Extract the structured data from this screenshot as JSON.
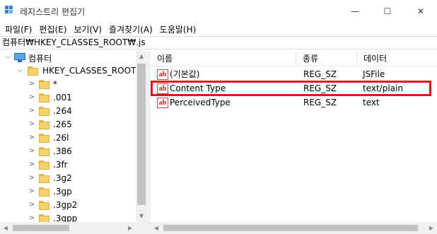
{
  "window": {
    "title": "레지스트리 편집기",
    "icon": "registry-editor-icon",
    "controls": {
      "minimize": "—",
      "maximize": "☐",
      "close": "✕"
    }
  },
  "menu": [
    {
      "label": "파일(F)"
    },
    {
      "label": "편집(E)"
    },
    {
      "label": "보기(V)"
    },
    {
      "label": "즐겨찾기(A)"
    },
    {
      "label": "도움말(H)"
    }
  ],
  "address": "컴퓨터₩HKEY_CLASSES_ROOT₩.js",
  "tree": {
    "root": {
      "label": "컴퓨터",
      "expander": "⌵",
      "icon": "computer-icon"
    },
    "hive": {
      "label": "HKEY_CLASSES_ROOT",
      "expander": "⌵"
    },
    "children": [
      {
        "label": "*"
      },
      {
        "label": ".001"
      },
      {
        "label": ".264"
      },
      {
        "label": ".265"
      },
      {
        "label": ".26l"
      },
      {
        "label": ".386"
      },
      {
        "label": ".3fr"
      },
      {
        "label": ".3g2"
      },
      {
        "label": ".3gp"
      },
      {
        "label": ".3gp2"
      },
      {
        "label": ".3gpp"
      }
    ],
    "child_expander": ">"
  },
  "list": {
    "columns": [
      "이름",
      "종류",
      "데이터"
    ],
    "rows": [
      {
        "name": "(기본값)",
        "type": "REG_SZ",
        "data": "JSFile"
      },
      {
        "name": "Content Type",
        "type": "REG_SZ",
        "data": "text/plain"
      },
      {
        "name": "PerceivedType",
        "type": "REG_SZ",
        "data": "text"
      }
    ],
    "value_icon_text": "ab",
    "highlighted_row_index": 1
  },
  "colors": {
    "highlight_border": "#e0141e",
    "folder": "#f6d26b",
    "value_icon": "#b02020"
  }
}
